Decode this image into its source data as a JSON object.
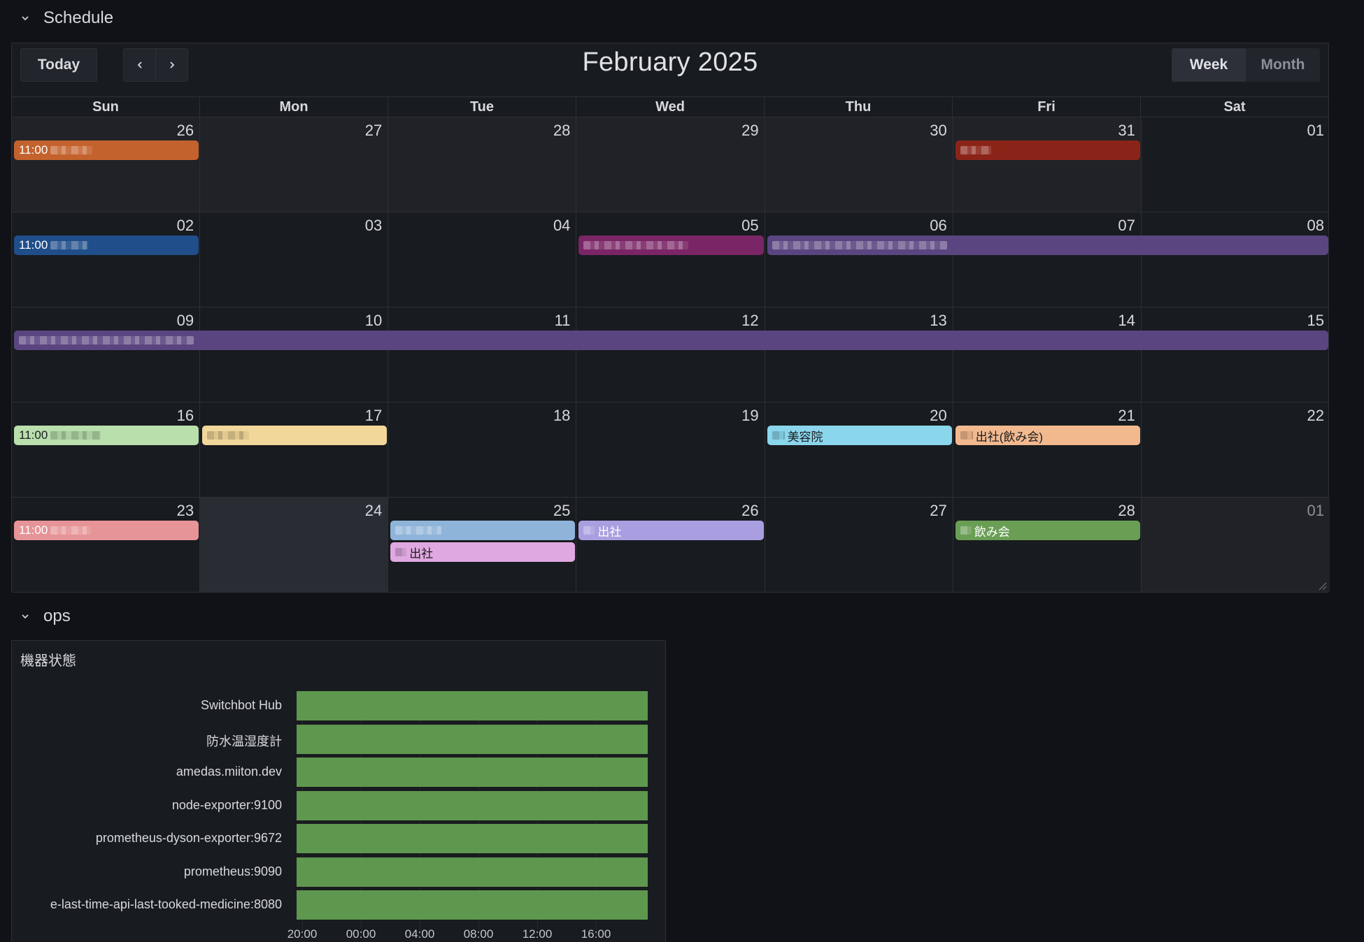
{
  "rows": {
    "schedule_title": "Schedule",
    "ops_title": "ops"
  },
  "calendar": {
    "today_label": "Today",
    "title": "February 2025",
    "views": [
      "Week",
      "Month"
    ],
    "active_view": "Week",
    "weekdays": [
      "Sun",
      "Mon",
      "Tue",
      "Wed",
      "Thu",
      "Fri",
      "Sat"
    ],
    "weeks": [
      [
        "26",
        "27",
        "28",
        "29",
        "30",
        "31",
        "01"
      ],
      [
        "02",
        "03",
        "04",
        "05",
        "06",
        "07",
        "08"
      ],
      [
        "09",
        "10",
        "11",
        "12",
        "13",
        "14",
        "15"
      ],
      [
        "16",
        "17",
        "18",
        "19",
        "20",
        "21",
        "22"
      ],
      [
        "23",
        "24",
        "25",
        "26",
        "27",
        "28",
        "01"
      ]
    ],
    "events": [
      {
        "week": 0,
        "start": 0,
        "span": 1,
        "lane": 0,
        "time": "11:00",
        "text": "",
        "color": "#c4622d",
        "dark": false,
        "blur": 60
      },
      {
        "week": 0,
        "start": 5,
        "span": 1,
        "lane": 0,
        "time": "",
        "text": "",
        "color": "#8b2418",
        "dark": false,
        "blur": 44
      },
      {
        "week": 1,
        "start": 0,
        "span": 1,
        "lane": 0,
        "time": "11:00",
        "text": "",
        "color": "#1f4e8a",
        "dark": false,
        "blur": 54
      },
      {
        "week": 1,
        "start": 3,
        "span": 1,
        "lane": 0,
        "time": "",
        "text": "",
        "color": "#7a2566",
        "dark": false,
        "blur": 150
      },
      {
        "week": 1,
        "start": 4,
        "span": 3,
        "lane": 0,
        "time": "",
        "text": "",
        "color": "#5a4580",
        "dark": false,
        "blur": 250
      },
      {
        "week": 2,
        "start": 0,
        "span": 7,
        "lane": 0,
        "time": "",
        "text": "",
        "color": "#5a4580",
        "dark": false,
        "blur": 250
      },
      {
        "week": 3,
        "start": 0,
        "span": 1,
        "lane": 0,
        "time": "11:00",
        "text": "",
        "color": "#b9dfad",
        "dark": true,
        "blur": 72
      },
      {
        "week": 3,
        "start": 1,
        "span": 1,
        "lane": 0,
        "time": "",
        "text": "",
        "color": "#f2d79a",
        "dark": true,
        "blur": 60
      },
      {
        "week": 3,
        "start": 4,
        "span": 1,
        "lane": 0,
        "time": "",
        "text": "美容院",
        "color": "#8ad6ec",
        "dark": true,
        "blur": 18
      },
      {
        "week": 3,
        "start": 5,
        "span": 1,
        "lane": 0,
        "time": "",
        "text": "出社(飲み会)",
        "color": "#f2b98e",
        "dark": true,
        "blur": 18
      },
      {
        "week": 4,
        "start": 0,
        "span": 1,
        "lane": 0,
        "time": "11:00",
        "text": "",
        "color": "#e69497",
        "dark": false,
        "blur": 58
      },
      {
        "week": 4,
        "start": 2,
        "span": 1,
        "lane": 0,
        "time": "",
        "text": "",
        "color": "#8fb4d9",
        "dark": false,
        "blur": 66
      },
      {
        "week": 4,
        "start": 2,
        "span": 1,
        "lane": 1,
        "time": "",
        "text": "出社",
        "color": "#e0a8e0",
        "dark": true,
        "blur": 16
      },
      {
        "week": 4,
        "start": 3,
        "span": 1,
        "lane": 0,
        "time": "",
        "text": "出社",
        "color": "#a99fe0",
        "dark": false,
        "blur": 16
      },
      {
        "week": 4,
        "start": 5,
        "span": 1,
        "lane": 0,
        "time": "",
        "text": "飲み会",
        "color": "#6a9e55",
        "dark": false,
        "blur": 16
      }
    ]
  },
  "ops": {
    "panel_title": "機器状態",
    "state_color": "#629e51",
    "items": [
      "Switchbot Hub",
      "防水温湿度計",
      "amedas.miiton.dev",
      "node-exporter:9100",
      "prometheus-dyson-exporter:9672",
      "prometheus:9090",
      "e-last-time-api-last-tooked-medicine:8080"
    ],
    "ticks": [
      "20:00",
      "00:00",
      "04:00",
      "08:00",
      "12:00",
      "16:00"
    ]
  }
}
